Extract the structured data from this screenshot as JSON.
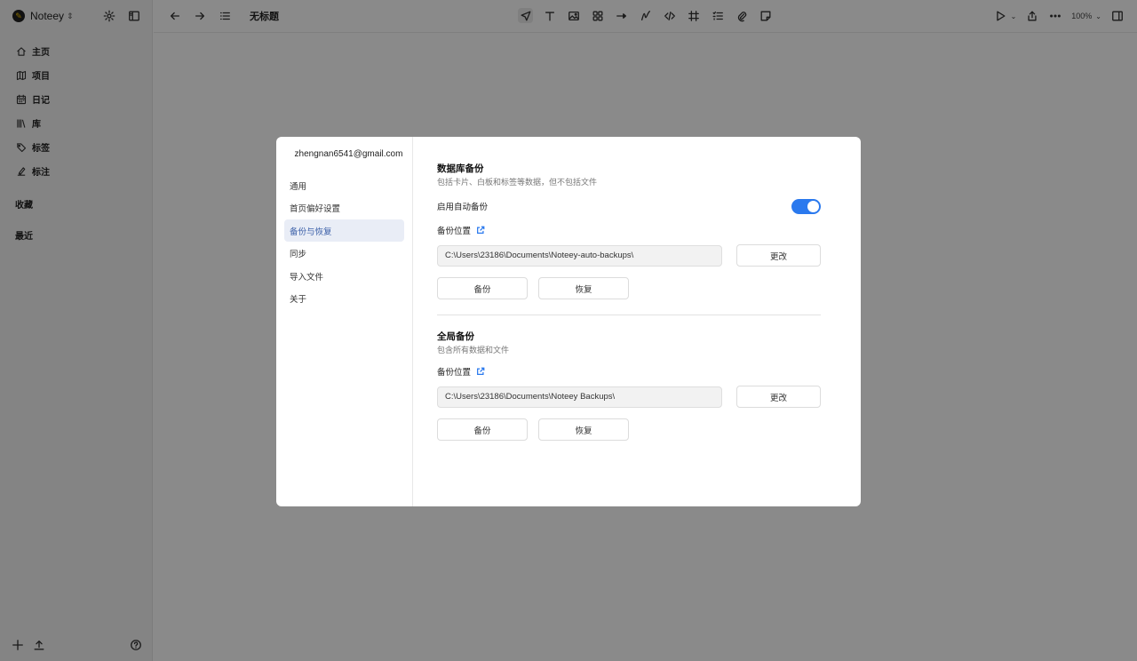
{
  "app": {
    "name": "Noteey",
    "doc_title": "无标题",
    "zoom": "100%"
  },
  "sidebar": {
    "items": [
      {
        "label": "主页",
        "icon": "home-icon"
      },
      {
        "label": "项目",
        "icon": "map-icon"
      },
      {
        "label": "日记",
        "icon": "calendar-icon"
      },
      {
        "label": "库",
        "icon": "library-icon"
      },
      {
        "label": "标签",
        "icon": "tag-icon"
      },
      {
        "label": "标注",
        "icon": "highlighter-icon"
      }
    ],
    "favorites": "收藏",
    "recent": "最近"
  },
  "settings": {
    "email": "zhengnan6541@gmail.com",
    "menu": [
      "通用",
      "首页偏好设置",
      "备份与恢复",
      "同步",
      "导入文件",
      "关于"
    ],
    "active_index": 2,
    "db_backup": {
      "title": "数据库备份",
      "desc": "包括卡片、白板和标签等数据，但不包括文件",
      "auto_label": "启用自动备份",
      "auto_enabled": true,
      "location_label": "备份位置",
      "path": "C:\\Users\\23186\\Documents\\Noteey-auto-backups\\",
      "change_label": "更改",
      "backup_label": "备份",
      "restore_label": "恢复"
    },
    "full_backup": {
      "title": "全局备份",
      "desc": "包含所有数据和文件",
      "location_label": "备份位置",
      "path": "C:\\Users\\23186\\Documents\\Noteey Backups\\",
      "change_label": "更改",
      "backup_label": "备份",
      "restore_label": "恢复"
    },
    "accent_color": "#2a79ee"
  }
}
